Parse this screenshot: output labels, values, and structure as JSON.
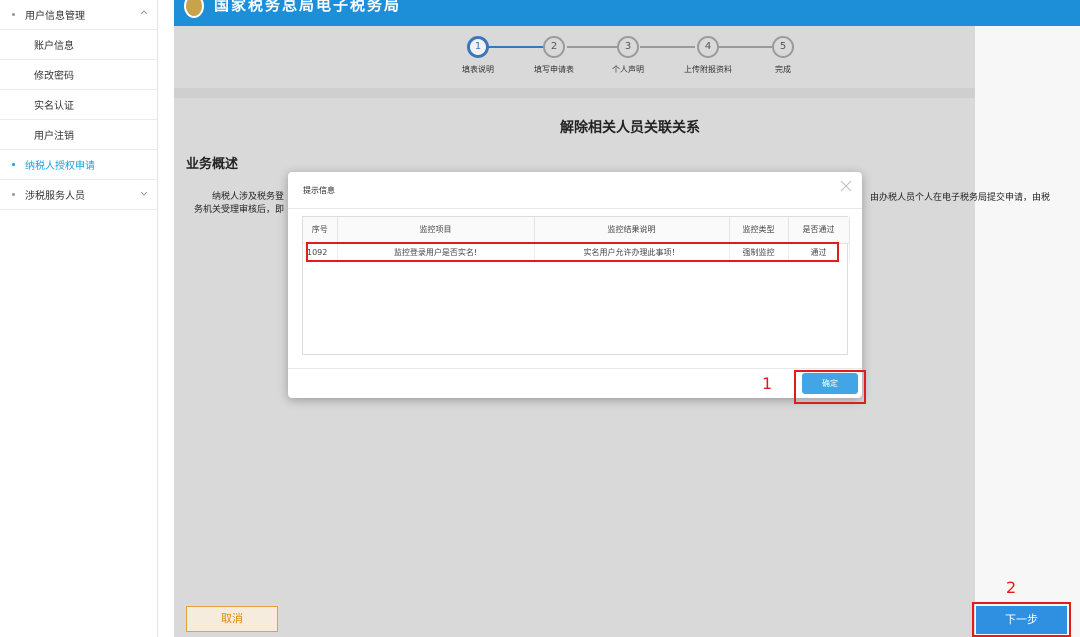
{
  "header": {
    "title": "国家税务总局电子税务局"
  },
  "sidebar": {
    "items": [
      {
        "label": "用户信息管理",
        "type": "group",
        "expanded": true
      },
      {
        "label": "账户信息",
        "type": "sub"
      },
      {
        "label": "修改密码",
        "type": "sub"
      },
      {
        "label": "实名认证",
        "type": "sub"
      },
      {
        "label": "用户注销",
        "type": "sub"
      },
      {
        "label": "纳税人授权申请",
        "type": "group",
        "active": true
      },
      {
        "label": "涉税服务人员",
        "type": "group",
        "expanded": false
      }
    ]
  },
  "steps": [
    {
      "num": "1",
      "label": "填表说明",
      "active": true
    },
    {
      "num": "2",
      "label": "填写申请表"
    },
    {
      "num": "3",
      "label": "个人声明"
    },
    {
      "num": "4",
      "label": "上传附报资料"
    },
    {
      "num": "5",
      "label": "完成"
    }
  ],
  "page": {
    "title": "解除相关人员关联关系",
    "section_title": "业务概述",
    "overview_line1": "纳税人涉及税务登",
    "overview_line2": "务机关受理审核后，即",
    "overview_right": "由办税人员个人在电子税务局提交申请，由税"
  },
  "modal": {
    "title": "提示信息",
    "columns": [
      "序号",
      "监控项目",
      "监控结果说明",
      "监控类型",
      "是否通过"
    ],
    "rows": [
      [
        "1092",
        "监控登录用户是否实名!",
        "实名用户允许办理此事项！",
        "强制监控",
        "通过"
      ]
    ],
    "ok_label": "确定"
  },
  "annotations": {
    "label1": "1",
    "label2": "2"
  },
  "footer": {
    "cancel_label": "取消",
    "next_label": "下一步"
  },
  "colors": {
    "accent": "#1a9fe0",
    "annotation": "#e01c1c",
    "cancel": "#e08a12"
  }
}
